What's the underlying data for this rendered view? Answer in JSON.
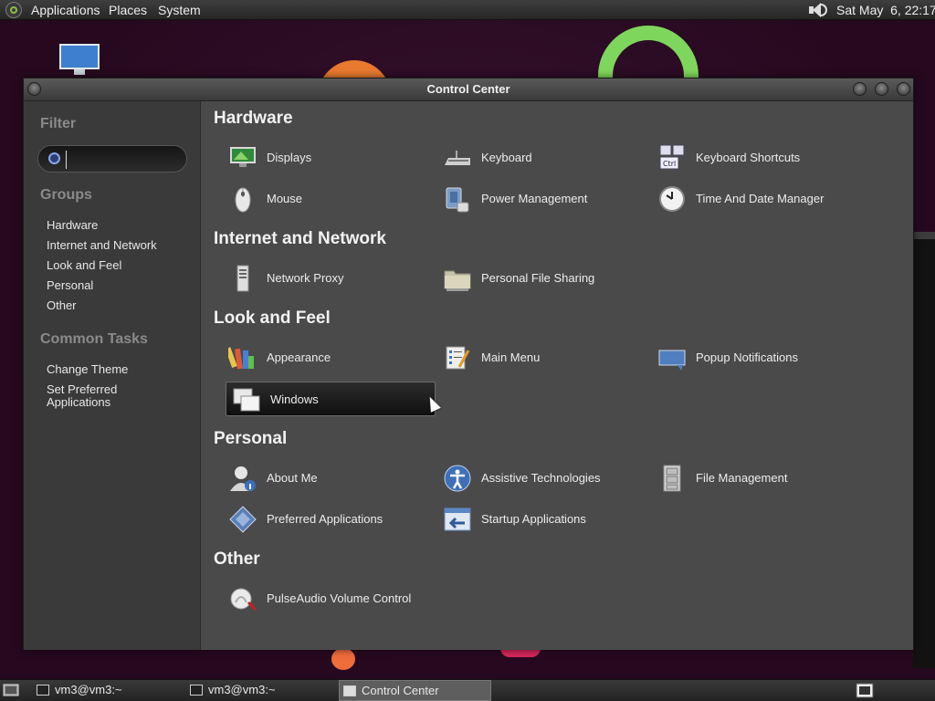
{
  "top_panel": {
    "menus": [
      "Applications",
      "Places",
      "System"
    ],
    "clock": "Sat May  6, 22:17"
  },
  "window": {
    "title": "Control Center"
  },
  "sidebar": {
    "filter_heading": "Filter",
    "search_value": "",
    "groups_heading": "Groups",
    "groups": [
      "Hardware",
      "Internet and Network",
      "Look and Feel",
      "Personal",
      "Other"
    ],
    "tasks_heading": "Common Tasks",
    "tasks": [
      "Change Theme",
      "Set Preferred Applications"
    ]
  },
  "sections": [
    {
      "title": "Hardware",
      "items": [
        {
          "label": "Displays",
          "icon": "display-icon"
        },
        {
          "label": "Keyboard",
          "icon": "keyboard-icon"
        },
        {
          "label": "Keyboard Shortcuts",
          "icon": "keyboard-shortcuts-icon"
        },
        {
          "label": "Mouse",
          "icon": "mouse-icon"
        },
        {
          "label": "Power Management",
          "icon": "power-management-icon"
        },
        {
          "label": "Time And Date Manager",
          "icon": "clock-icon"
        }
      ]
    },
    {
      "title": "Internet and Network",
      "items": [
        {
          "label": "Network Proxy",
          "icon": "network-proxy-icon"
        },
        {
          "label": "Personal File Sharing",
          "icon": "folder-share-icon"
        }
      ]
    },
    {
      "title": "Look and Feel",
      "items": [
        {
          "label": "Appearance",
          "icon": "appearance-icon"
        },
        {
          "label": "Main Menu",
          "icon": "main-menu-icon"
        },
        {
          "label": "Popup Notifications",
          "icon": "popup-notification-icon"
        },
        {
          "label": "Windows",
          "icon": "windows-icon",
          "selected": true
        }
      ]
    },
    {
      "title": "Personal",
      "items": [
        {
          "label": "About Me",
          "icon": "about-me-icon"
        },
        {
          "label": "Assistive Technologies",
          "icon": "accessibility-icon"
        },
        {
          "label": "File Management",
          "icon": "file-cabinet-icon"
        },
        {
          "label": "Preferred Applications",
          "icon": "preferred-apps-icon"
        },
        {
          "label": "Startup Applications",
          "icon": "startup-apps-icon"
        }
      ]
    },
    {
      "title": "Other",
      "items": [
        {
          "label": "PulseAudio Volume Control",
          "icon": "pulseaudio-icon"
        }
      ]
    }
  ],
  "taskbar": {
    "tasks": [
      {
        "label": "vm3@vm3:~",
        "active": false
      },
      {
        "label": "vm3@vm3:~",
        "active": false
      },
      {
        "label": "Control Center",
        "active": true
      }
    ]
  }
}
